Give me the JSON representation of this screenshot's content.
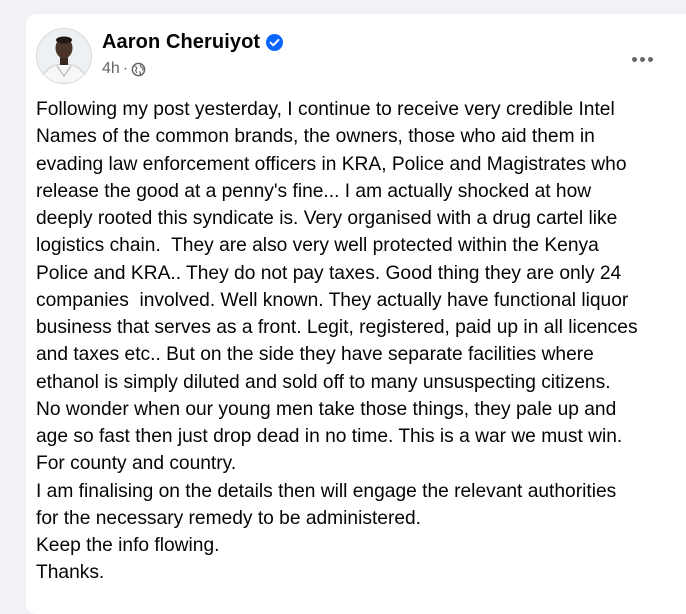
{
  "post": {
    "author": "Aaron Cheruiyot",
    "verified": true,
    "time": "4h",
    "separator": "·",
    "audience_icon": "globe-icon",
    "more_icon": "more-options-icon",
    "lines": [
      "Following my post yesterday, I continue to receive very credible Intel",
      "Names of the common brands, the owners, those who aid them in",
      "evading law enforcement officers in KRA, Police and Magistrates who",
      "release the good at a penny's fine... I am actually shocked at how",
      "deeply rooted this syndicate is. Very organised with a drug cartel like",
      "logistics chain.  They are also very well protected within the Kenya",
      "Police and KRA.. They do not pay taxes. Good thing they are only 24",
      "companies  involved. Well known. They actually have functional liquor",
      "business that serves as a front. Legit, registered, paid up in all licences",
      "and taxes etc.. But on the side they have separate facilities where",
      "ethanol is simply diluted and sold off to many unsuspecting citizens.",
      "No wonder when our young men take those things, they pale up and",
      "age so fast then just drop dead in no time. This is a war we must win.",
      "For county and country.",
      "I am finalising on the details then will engage the relevant authorities",
      "for the necessary remedy to be administered.",
      "Keep the info flowing.",
      "Thanks."
    ]
  },
  "colors": {
    "background": "#f0f2f5",
    "card": "#ffffff",
    "text_primary": "#050505",
    "text_secondary": "#65676b",
    "verified_badge": "#0866ff"
  }
}
